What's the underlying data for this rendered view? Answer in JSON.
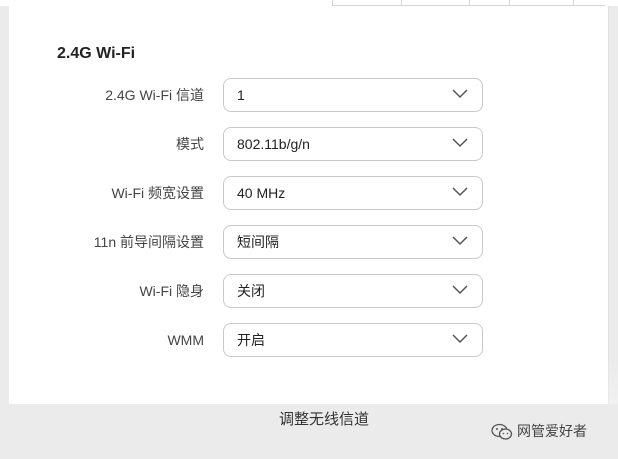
{
  "section": {
    "title": "2.4G Wi-Fi"
  },
  "settings": [
    {
      "label": "2.4G Wi-Fi 信道",
      "value": "1"
    },
    {
      "label": "模式",
      "value": "802.11b/g/n"
    },
    {
      "label": "Wi-Fi 频宽设置",
      "value": "40 MHz"
    },
    {
      "label": "11n 前导间隔设置",
      "value": "短间隔"
    },
    {
      "label": "Wi-Fi 隐身",
      "value": "关闭"
    },
    {
      "label": "WMM",
      "value": "开启"
    }
  ],
  "caption": "调整无线信道",
  "watermark": {
    "text": "网管爱好者",
    "icon": "wechat-icon"
  },
  "colors": {
    "border": "#c9c9c9",
    "background": "#ebebeb",
    "panel": "#ffffff"
  }
}
